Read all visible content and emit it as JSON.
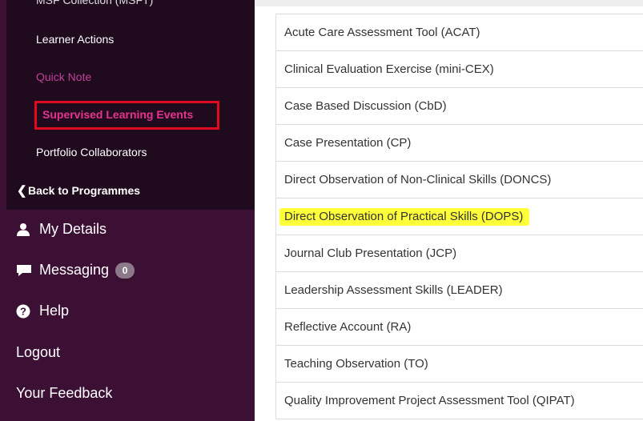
{
  "sidebar": {
    "sub_items": {
      "cutoff": "MSF Collection (MSFT)",
      "learner_actions": "Learner Actions",
      "quick_note": "Quick Note",
      "supervised_learning_events": "Supervised Learning Events",
      "portfolio_collaborators": "Portfolio Collaborators"
    },
    "back_to_programmes": "Back to Programmes",
    "menu": {
      "my_details": "My Details",
      "messaging": "Messaging",
      "messaging_count": "0",
      "help": "Help",
      "logout": "Logout",
      "your_feedback": "Your Feedback"
    }
  },
  "sle_list": {
    "items": [
      "Acute Care Assessment Tool (ACAT)",
      "Clinical Evaluation Exercise (mini-CEX)",
      "Case Based Discussion (CbD)",
      "Case Presentation (CP)",
      "Direct Observation of Non-Clinical Skills (DONCS)",
      "Direct Observation of Practical Skills (DOPS)",
      "Journal Club Presentation (JCP)",
      "Leadership Assessment Skills (LEADER)",
      "Reflective Account (RA)",
      "Teaching Observation (TO)",
      "Quality Improvement Project Assessment Tool (QIPAT)"
    ]
  },
  "colors": {
    "sidebar_bg": "#3c1035",
    "sub_panel_bg": "#200b1e",
    "active_pink": "#e6338f",
    "highlight_box": "#e00b1c",
    "highlight_marker": "#ffff3a"
  }
}
